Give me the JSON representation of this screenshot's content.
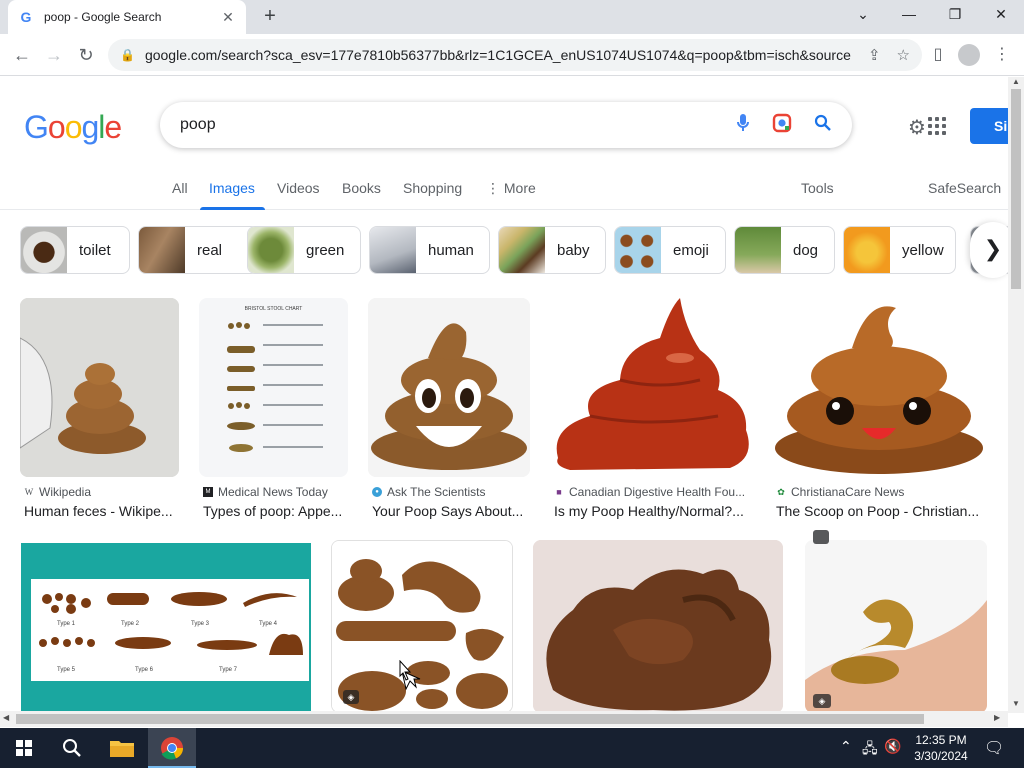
{
  "browser": {
    "tab_title": "poop - Google Search",
    "tab_favicon": "G",
    "url": "google.com/search?sca_esv=177e7810b56377bb&rlz=1C1GCEA_enUS1074US1074&q=poop&tbm=isch&source..."
  },
  "google": {
    "logo_letters": [
      "G",
      "o",
      "o",
      "g",
      "l",
      "e"
    ],
    "logo_colors": [
      "#4285F4",
      "#EA4335",
      "#FBBC05",
      "#4285F4",
      "#34A853",
      "#EA4335"
    ],
    "query": "poop",
    "signin_label": "Si"
  },
  "tabs": {
    "all": "All",
    "images": "Images",
    "videos": "Videos",
    "books": "Books",
    "shopping": "Shopping",
    "more": "More",
    "tools": "Tools",
    "safesearch": "SafeSearch"
  },
  "chips": [
    {
      "label": "toilet"
    },
    {
      "label": "real"
    },
    {
      "label": "green"
    },
    {
      "label": "human"
    },
    {
      "label": "baby"
    },
    {
      "label": "emoji"
    },
    {
      "label": "dog"
    },
    {
      "label": "yellow"
    }
  ],
  "results_row1": [
    {
      "source": "Wikipedia",
      "caption": "Human feces - Wikipe..."
    },
    {
      "source": "Medical News Today",
      "caption": "Types of poop: Appe..."
    },
    {
      "source": "Ask The Scientists",
      "caption": "Your Poop Says About..."
    },
    {
      "source": "Canadian Digestive Health Fou...",
      "caption": "Is my Poop Healthy/Normal?..."
    },
    {
      "source": "ChristianaCare News",
      "caption": "The Scoop on Poop - Christian..."
    }
  ],
  "stool_chart": {
    "title": "BRISTOL STOOL CHART",
    "types": [
      "Type 1",
      "Type 2",
      "Type 3",
      "Type 4",
      "Type 5",
      "Type 6",
      "Type 7"
    ]
  },
  "taskbar": {
    "time": "12:35 PM",
    "date": "3/30/2024"
  }
}
